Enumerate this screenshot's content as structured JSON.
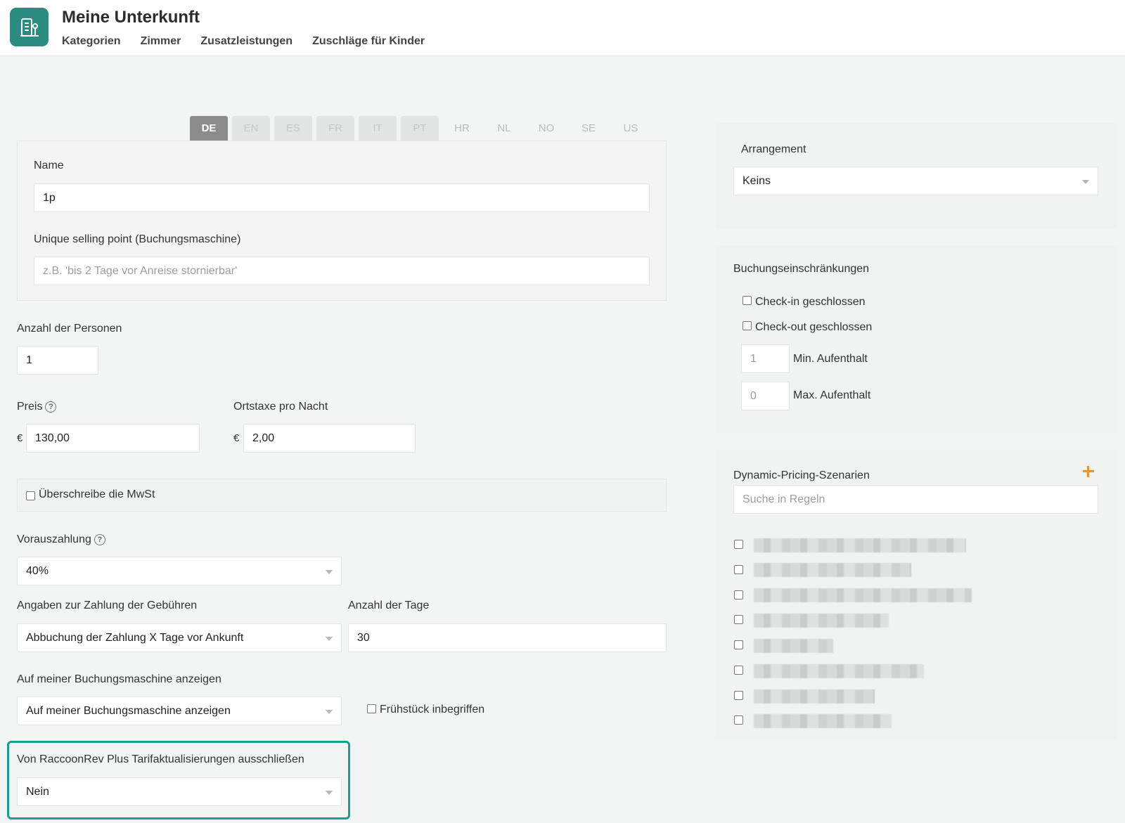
{
  "header": {
    "title": "Meine Unterkunft",
    "logo_icon": "building-icon",
    "nav": [
      "Kategorien",
      "Zimmer",
      "Zusatzleistungen",
      "Zuschläge für Kinder"
    ]
  },
  "languages": {
    "tabs": [
      "DE",
      "EN",
      "ES",
      "FR",
      "IT",
      "PT",
      "HR",
      "NL",
      "NO",
      "SE",
      "US"
    ],
    "active": "DE"
  },
  "form": {
    "name_label": "Name",
    "name_value": "1p",
    "usp_label": "Unique selling point (Buchungsmaschine)",
    "usp_placeholder": "z.B. 'bis 2 Tage vor Anreise stornierbar'",
    "persons_label": "Anzahl der Personen",
    "persons_value": "1",
    "price_label": "Preis",
    "price_currency": "€",
    "price_value": "130,00",
    "tax_label": "Ortstaxe pro Nacht",
    "tax_currency": "€",
    "tax_value": "2,00",
    "mwst_label": "Überschreibe die MwSt",
    "prepayment_label": "Vorauszahlung",
    "prepayment_value": "40%",
    "fee_info_label": "Angaben zur Zahlung der Gebühren",
    "fee_info_value": "Abbuchung der Zahlung X Tage vor Ankunft",
    "days_label": "Anzahl der Tage",
    "days_value": "30",
    "show_label": "Auf meiner Buchungsmaschine anzeigen",
    "show_value": "Auf meiner Buchungsmaschine anzeigen",
    "breakfast_label": "Frühstück inbegriffen",
    "exclude_label": "Von RaccoonRev Plus Tarifaktualisierungen ausschließen",
    "exclude_value": "Nein"
  },
  "arrangement": {
    "label": "Arrangement",
    "value": "Keins"
  },
  "restrictions": {
    "title": "Buchungseinschränkungen",
    "checkin_label": "Check-in geschlossen",
    "checkout_label": "Check-out geschlossen",
    "min_value": "1",
    "min_label": "Min. Aufenthalt",
    "max_value": "0",
    "max_label": "Max. Aufenthalt"
  },
  "pricing": {
    "title": "Dynamic-Pricing-Szenarien",
    "add_icon": "plus-icon",
    "search_placeholder": "Suche in Regeln",
    "accent_color": "#f5922a"
  },
  "colors": {
    "brand": "#2a8c80",
    "highlight": "#1a9e8e"
  }
}
